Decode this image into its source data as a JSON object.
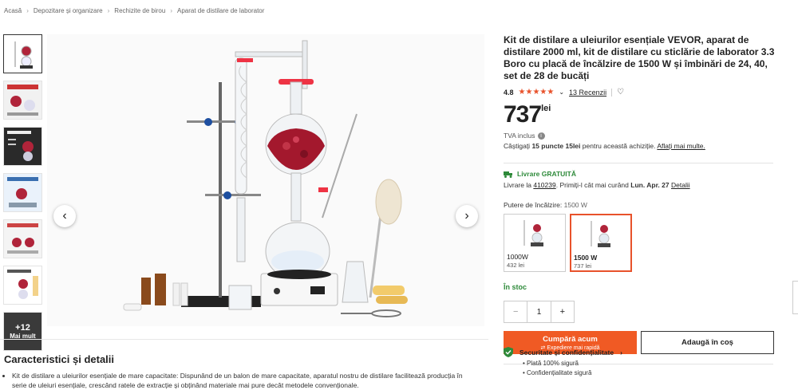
{
  "breadcrumb": {
    "items": [
      "Acasă",
      "Depozitare și organizare",
      "Rechizite de birou",
      "Aparat de distilare de laborator"
    ]
  },
  "gallery": {
    "more_count": "+12",
    "more_label": "Mai mult"
  },
  "product": {
    "title": "Kit de distilare a uleiurilor esențiale VEVOR, aparat de distilare 2000 ml, kit de distilare cu sticlărie de laborator 3.3 Boro cu placă de încălzire de 1500 W și îmbinări de 24, 40, set de 28 de bucăți",
    "rating": "4.8",
    "stars": 4.8,
    "reviews": "13 Recenzii",
    "price": "737",
    "currency": "lei",
    "vat": "TVA inclus",
    "points_prefix": "Câștigați",
    "points_bold": "15 puncte 15lei",
    "points_suffix": "pentru această achiziție.",
    "points_link": "Aflați mai multe."
  },
  "delivery": {
    "title": "Livrare GRATUITĂ",
    "line_prefix": "Livrare la",
    "postcode": "410239",
    "line_mid": ". Primiți-l cât mai curând",
    "date": "Lun. Apr. 27",
    "details": "Detalii"
  },
  "options": {
    "label": "Putere de încălzire:",
    "selected_value": "1500 W",
    "items": [
      {
        "name": "1000W",
        "price": "432 lei"
      },
      {
        "name": "1500 W",
        "price": "737 lei"
      }
    ]
  },
  "stock": "În stoc",
  "quantity": "1",
  "actions": {
    "buy": "Cumpără acum",
    "buy_sub": "Expediere mai rapidă",
    "add": "Adaugă în coș"
  },
  "security": {
    "title": "Securitate și confidențialitate",
    "items": [
      "Plată 100% sigură",
      "Confidențialitate sigură"
    ]
  },
  "details": {
    "title": "Caracteristici și detalii",
    "bullet": "Kit de distilare a uleiurilor esențiale de mare capacitate: Dispunând de un balon de mare capacitate, aparatul nostru de distilare facilitează producția în serie de uleiuri esențiale, crescând ratele de extracție și obținând materiale mai pure decât metodele convenționale."
  },
  "colors": {
    "accent": "#f05a24",
    "stars": "#e8522b",
    "success": "#2e8a3a"
  }
}
